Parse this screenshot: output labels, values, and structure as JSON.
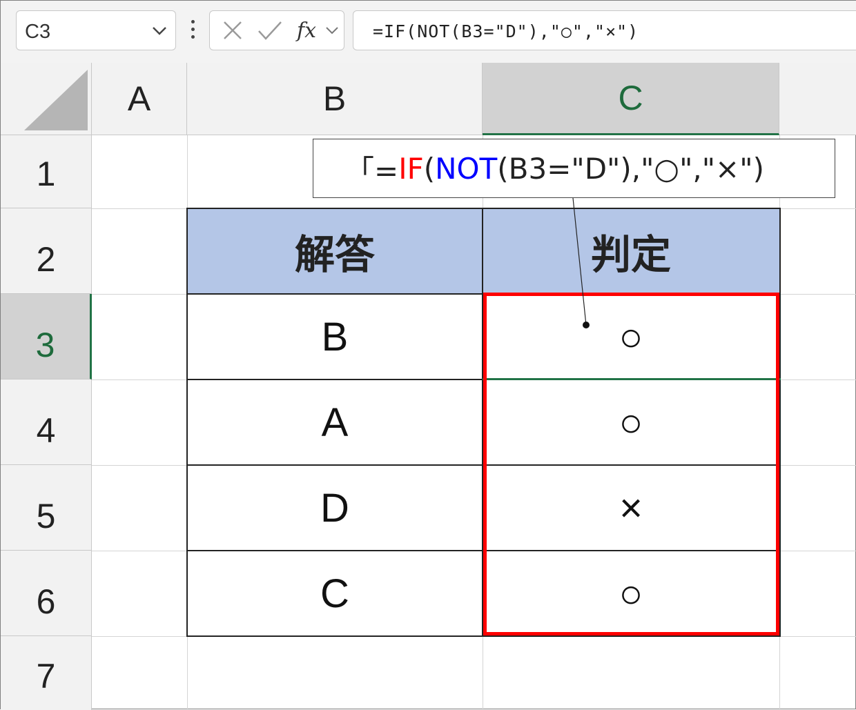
{
  "formula_bar": {
    "name_box": "C3",
    "formula": "=IF(NOT(B3=\"D\"),\"○\",\"×\")"
  },
  "columns": [
    "A",
    "B",
    "C"
  ],
  "rows": [
    "1",
    "2",
    "3",
    "4",
    "5",
    "6",
    "7"
  ],
  "selected_cell": "C3",
  "table": {
    "headers": [
      "解答",
      "判定"
    ],
    "rows": [
      [
        "B",
        "○"
      ],
      [
        "A",
        "○"
      ],
      [
        "D",
        "×"
      ],
      [
        "C",
        "○"
      ]
    ]
  },
  "callout": {
    "prefix": "「=",
    "if": "IF",
    "open1": "(",
    "not": "NOT",
    "rest": "(B3=\"D\"),\"○\",\"×\")"
  },
  "colors": {
    "header_fill": "#b4c6e7",
    "highlight_box": "#ff0000",
    "selection": "#217346",
    "function_if": "#ff0000",
    "function_not": "#0000ff"
  }
}
